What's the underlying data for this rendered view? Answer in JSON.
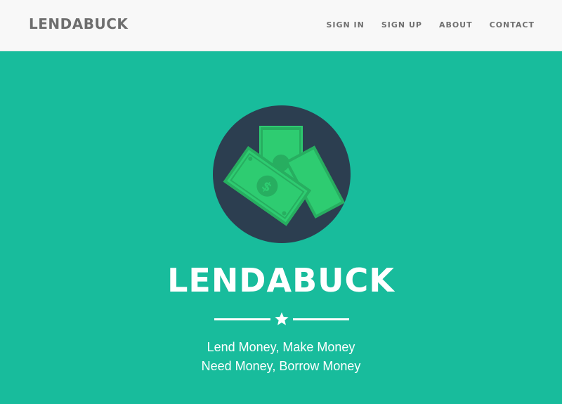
{
  "navbar": {
    "brand": "LENDABUCK",
    "links": [
      "SIGN IN",
      "SIGN UP",
      "ABOUT",
      "CONTACT"
    ]
  },
  "hero": {
    "icon": "money-bills-icon",
    "title": "LENDABUCK",
    "divider_icon": "star-icon",
    "taglines": [
      "Lend Money, Make Money",
      "Need Money, Borrow Money"
    ]
  },
  "colors": {
    "navbar_bg": "#f8f8f8",
    "brand_text": "#6e6e6e",
    "hero_bg": "#18bc9c",
    "circle": "#2c3e50",
    "bill_green": "#2ecc71",
    "bill_dark": "#27ae60"
  }
}
